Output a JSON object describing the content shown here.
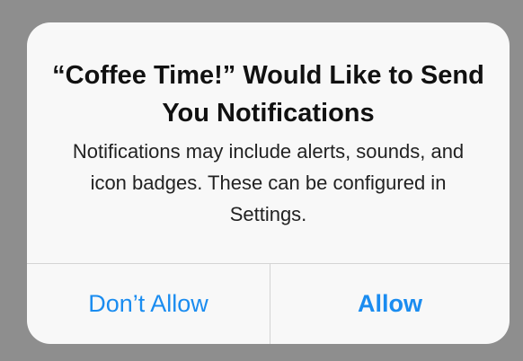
{
  "alert": {
    "title": "“Coffee Time!” Would Like to Send You Notifications",
    "message": "Notifications may include alerts, sounds, and icon badges. These can be configured in Settings.",
    "buttons": {
      "dont_allow": "Don’t Allow",
      "allow": "Allow"
    }
  },
  "colors": {
    "backdrop": "#8e8e8e",
    "alert_background": "#f8f8f8",
    "button_text": "#1a8cf0",
    "divider": "#d4d4d4"
  }
}
